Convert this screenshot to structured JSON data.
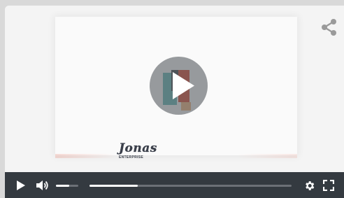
{
  "poster": {
    "brand_name": "Jonas",
    "brand_sub": "ENTERPRISE"
  },
  "player": {
    "progress": 0.24,
    "volume": 0.6
  },
  "icons": {
    "play_overlay": "play-icon",
    "share": "share-icon",
    "play": "play-icon",
    "volume": "volume-icon",
    "settings": "gear-icon",
    "fullscreen": "fullscreen-icon"
  },
  "colors": {
    "control_bar": "#343a40",
    "overlay": "#5a5f64",
    "logo_teal": "#5fb6b2",
    "logo_red": "#d8442e",
    "logo_dark": "#3b3f44"
  }
}
